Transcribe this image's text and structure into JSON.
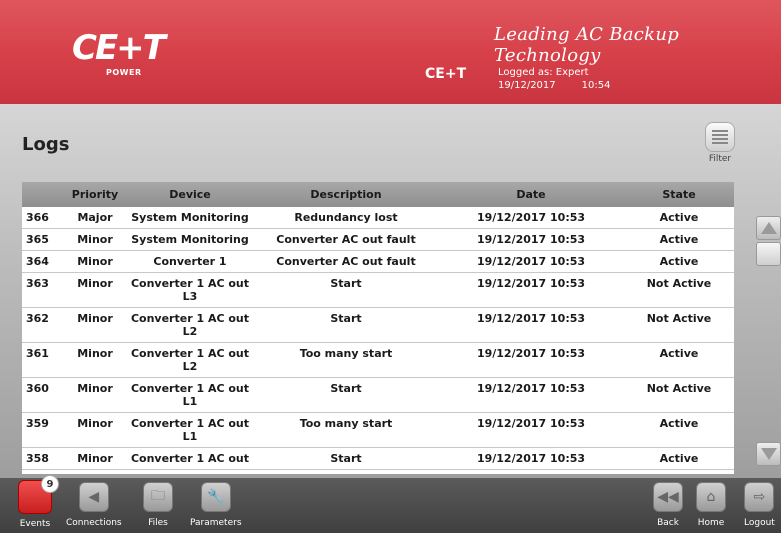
{
  "header": {
    "logo_text": "CE+T",
    "logo_sub": "POWER",
    "tagline": "Leading AC Backup Technology",
    "brand": "CE+T",
    "logged_as": "Logged as: Expert",
    "date": "19/12/2017",
    "time": "10:54"
  },
  "page": {
    "title": "Logs",
    "filter_label": "Filter"
  },
  "table": {
    "columns": [
      "",
      "Priority",
      "Device",
      "Description",
      "Date",
      "State"
    ],
    "rows": [
      {
        "id": "366",
        "priority": "Major",
        "device": "System Monitoring",
        "device2": "",
        "description": "Redundancy lost",
        "date": "19/12/2017 10:53",
        "state": "Active"
      },
      {
        "id": "365",
        "priority": "Minor",
        "device": "System Monitoring",
        "device2": "",
        "description": "Converter AC out fault",
        "date": "19/12/2017 10:53",
        "state": "Active"
      },
      {
        "id": "364",
        "priority": "Minor",
        "device": "Converter 1",
        "device2": "",
        "description": "Converter AC out fault",
        "date": "19/12/2017 10:53",
        "state": "Active"
      },
      {
        "id": "363",
        "priority": "Minor",
        "device": "Converter 1 AC out",
        "device2": "L3",
        "description": "Start",
        "date": "19/12/2017 10:53",
        "state": "Not Active"
      },
      {
        "id": "362",
        "priority": "Minor",
        "device": "Converter 1 AC out",
        "device2": "L2",
        "description": "Start",
        "date": "19/12/2017 10:53",
        "state": "Not Active"
      },
      {
        "id": "361",
        "priority": "Minor",
        "device": "Converter 1 AC out",
        "device2": "L2",
        "description": "Too many start",
        "date": "19/12/2017 10:53",
        "state": "Active"
      },
      {
        "id": "360",
        "priority": "Minor",
        "device": "Converter 1 AC out",
        "device2": "L1",
        "description": "Start",
        "date": "19/12/2017 10:53",
        "state": "Not Active"
      },
      {
        "id": "359",
        "priority": "Minor",
        "device": "Converter 1 AC out",
        "device2": "L1",
        "description": "Too many start",
        "date": "19/12/2017 10:53",
        "state": "Active"
      },
      {
        "id": "358",
        "priority": "Minor",
        "device": "Converter 1 AC out",
        "device2": "",
        "description": "Start",
        "date": "19/12/2017 10:53",
        "state": "Active"
      }
    ]
  },
  "toolbar": {
    "events_label": "Events",
    "events_badge": "9",
    "connections_label": "Connections",
    "files_label": "Files",
    "parameters_label": "Parameters",
    "back_label": "Back",
    "home_label": "Home",
    "logout_label": "Logout"
  },
  "icons": {
    "filter": "filter-icon",
    "scroll_up": "scroll-up-icon",
    "scroll_down": "scroll-down-icon",
    "events": "events-icon",
    "connections": "connections-icon",
    "files": "folder-icon",
    "parameters": "wrench-icon",
    "back": "rewind-icon",
    "home": "home-icon",
    "logout": "logout-icon"
  },
  "colors": {
    "header_red": "#d63f48",
    "events_red": "#e03a3a"
  }
}
